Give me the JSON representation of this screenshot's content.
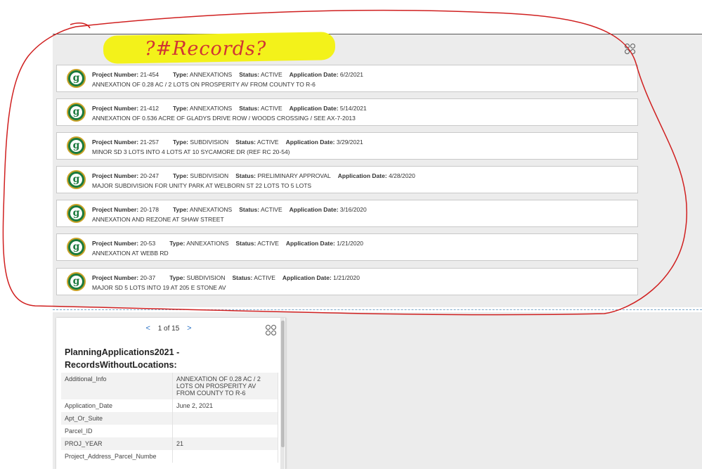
{
  "annotation": {
    "text": "?#Records?"
  },
  "records": [
    {
      "project_label": "Project Number:",
      "project_number": "21-454",
      "type_label": "Type:",
      "type": "ANNEXATIONS",
      "status_label": "Status:",
      "status": "ACTIVE",
      "date_label": "Application Date:",
      "date": "6/2/2021",
      "description": "ANNEXATION OF 0.28 AC / 2 LOTS ON PROSPERITY AV FROM COUNTY TO R-6"
    },
    {
      "project_label": "Project Number:",
      "project_number": "21-412",
      "type_label": "Type:",
      "type": "ANNEXATIONS",
      "status_label": "Status:",
      "status": "ACTIVE",
      "date_label": "Application Date:",
      "date": "5/14/2021",
      "description": "ANNEXATION OF 0.536 ACRE OF GLADYS DRIVE ROW / WOODS CROSSING / SEE AX-7-2013"
    },
    {
      "project_label": "Project Number:",
      "project_number": "21-257",
      "type_label": "Type:",
      "type": "SUBDIVISION",
      "status_label": "Status:",
      "status": "ACTIVE",
      "date_label": "Application Date:",
      "date": "3/29/2021",
      "description": "MINOR SD 3 LOTS INTO 4 LOTS AT 10 SYCAMORE DR (REF RC 20-54)"
    },
    {
      "project_label": "Project Number:",
      "project_number": "20-247",
      "type_label": "Type:",
      "type": "SUBDIVISION",
      "status_label": "Status:",
      "status": "PRELIMINARY APPROVAL",
      "date_label": "Application Date:",
      "date": "4/28/2020",
      "description": "MAJOR SUBDIVISION FOR UNITY PARK AT WELBORN ST 22 LOTS TO 5 LOTS"
    },
    {
      "project_label": "Project Number:",
      "project_number": "20-178",
      "type_label": "Type:",
      "type": "ANNEXATIONS",
      "status_label": "Status:",
      "status": "ACTIVE",
      "date_label": "Application Date:",
      "date": "3/16/2020",
      "description": "ANNEXATION AND REZONE  AT SHAW STREET"
    },
    {
      "project_label": "Project Number:",
      "project_number": "20-53",
      "type_label": "Type:",
      "type": "ANNEXATIONS",
      "status_label": "Status:",
      "status": "ACTIVE",
      "date_label": "Application Date:",
      "date": "1/21/2020",
      "description": "ANNEXATION AT WEBB RD"
    },
    {
      "project_label": "Project Number:",
      "project_number": "20-37",
      "type_label": "Type:",
      "type": "SUBDIVISION",
      "status_label": "Status:",
      "status": "ACTIVE",
      "date_label": "Application Date:",
      "date": "1/21/2020",
      "description": "MAJOR SD 5 LOTS INTO 19 AT 205 E STONE AV"
    }
  ],
  "popup": {
    "prev": "<",
    "pager_text": "1 of 15",
    "next": ">",
    "title": "PlanningApplications2021 - RecordsWithoutLocations:",
    "attributes": [
      {
        "key": "Additional_Info",
        "value": "ANNEXATION OF 0.28 AC / 2 LOTS ON PROSPERITY AV FROM COUNTY TO R-6"
      },
      {
        "key": "Application_Date",
        "value": "June 2, 2021"
      },
      {
        "key": "Apt_Or_Suite",
        "value": ""
      },
      {
        "key": "Parcel_ID",
        "value": ""
      },
      {
        "key": "PROJ_YEAR",
        "value": "21"
      },
      {
        "key": "Project_Address_Parcel_Numbe",
        "value": ""
      }
    ]
  },
  "colors": {
    "annotation_red": "#d03434",
    "highlight_yellow": "#f3f21a",
    "logo_green": "#1b7a3d",
    "link_blue": "#2b73c7"
  },
  "icons": {
    "widget": "grid-icon",
    "logo": "city-seal-icon"
  }
}
